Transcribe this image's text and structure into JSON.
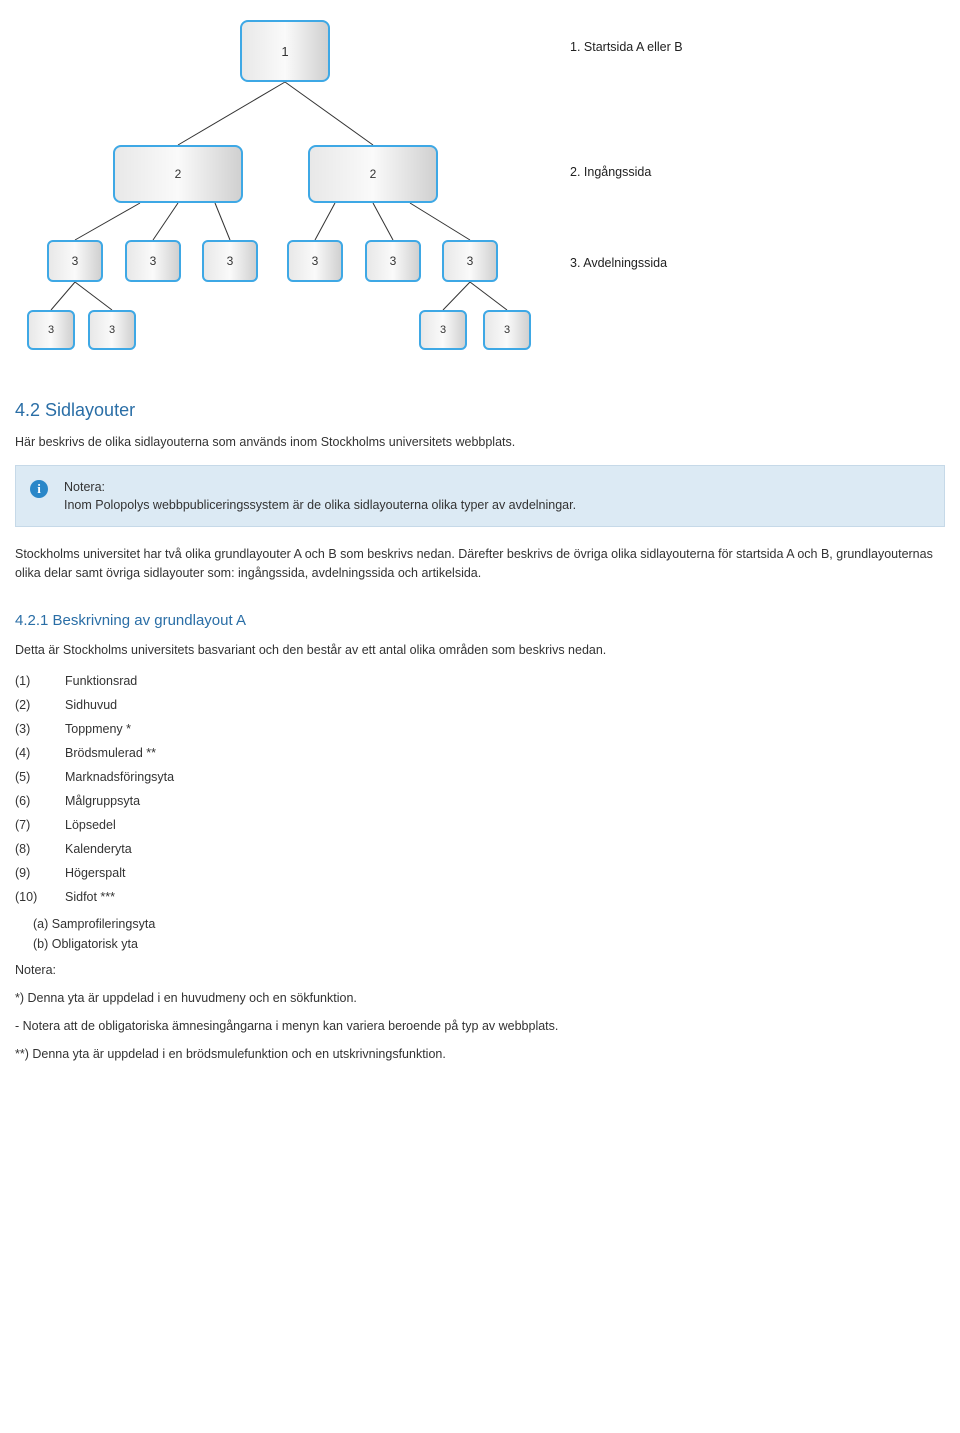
{
  "diagram": {
    "level1_label": "1",
    "level2_label": "2",
    "level3_label": "3",
    "legend1": "1. Startsida A eller B",
    "legend2": "2. Ingångssida",
    "legend3": "3. Avdelningssida"
  },
  "section_4_2": {
    "heading": "4.2 Sidlayouter",
    "intro": "Här beskrivs de olika sidlayouterna som används inom Stockholms universitets webbplats.",
    "info_title": "Notera:",
    "info_body": "Inom Polopolys webbpubliceringssystem är de olika sidlayouterna olika typer av avdelningar.",
    "para2": "Stockholms universitet har två olika grundlayouter A och B som beskrivs nedan. Därefter beskrivs de övriga olika sidlayouterna för startsida A och B, grundlayouternas olika delar samt övriga sidlayouter som: ingångssida, avdelningssida och artikelsida."
  },
  "section_4_2_1": {
    "heading": "4.2.1 Beskrivning av grundlayout A",
    "intro": "Detta är Stockholms universitets basvariant och den består av ett antal olika områden som beskrivs nedan.",
    "items": [
      {
        "n": "(1)",
        "t": "Funktionsrad"
      },
      {
        "n": "(2)",
        "t": "Sidhuvud"
      },
      {
        "n": "(3)",
        "t": "Toppmeny *"
      },
      {
        "n": "(4)",
        "t": "Brödsmulerad **"
      },
      {
        "n": "(5)",
        "t": "Marknadsföringsyta"
      },
      {
        "n": "(6)",
        "t": "Målgruppsyta"
      },
      {
        "n": "(7)",
        "t": "Löpsedel"
      },
      {
        "n": "(8)",
        "t": "Kalenderyta"
      },
      {
        "n": "(9)",
        "t": "Högerspalt"
      },
      {
        "n": "(10)",
        "t": "Sidfot ***"
      }
    ],
    "sub_a": "(a) Samprofileringsyta",
    "sub_b": "(b) Obligatorisk yta",
    "notera_label": "Notera:",
    "note_star": "*) Denna yta är uppdelad i en huvudmeny och en sökfunktion.",
    "note_dash": "- Notera att de obligatoriska ämnesingångarna i menyn kan variera beroende på typ av webbplats.",
    "note_dstar": "**) Denna yta är uppdelad i en brödsmulefunktion och en utskrivningsfunktion."
  }
}
